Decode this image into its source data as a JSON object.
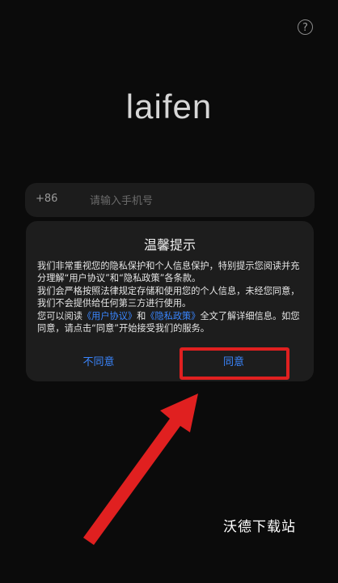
{
  "help": {
    "icon": "question-circle-icon",
    "glyph": "?"
  },
  "logo": {
    "text": "laifen"
  },
  "phone": {
    "country_code": "+86",
    "placeholder": "请输入手机号",
    "value": ""
  },
  "dialog": {
    "title": "温馨提示",
    "p1": "我们非常重视您的隐私保护和个人信息保护，特别提示您阅读并充分理解“用户协议”和“隐私政策”各条款。",
    "p2": "我们会严格按照法律规定存储和使用您的个人信息，未经您同意，我们不会提供给任何第三方进行使用。",
    "p3_before": "您可以阅读",
    "user_agreement": "《用户协议》",
    "p3_and": "和",
    "privacy_policy": "《隐私政策》",
    "p3_after": "全文了解详细信息。如您同意，请点击“同意”开始接受我们的服务。",
    "disagree_label": "不同意",
    "agree_label": "同意"
  },
  "annotation": {
    "highlight_color": "#e02020",
    "arrow_color": "#e02020"
  },
  "watermark": "沃德下载站",
  "colors": {
    "background": "#0b0b0b",
    "dialog": "#1d1d1d",
    "accent": "#3a86ff"
  }
}
